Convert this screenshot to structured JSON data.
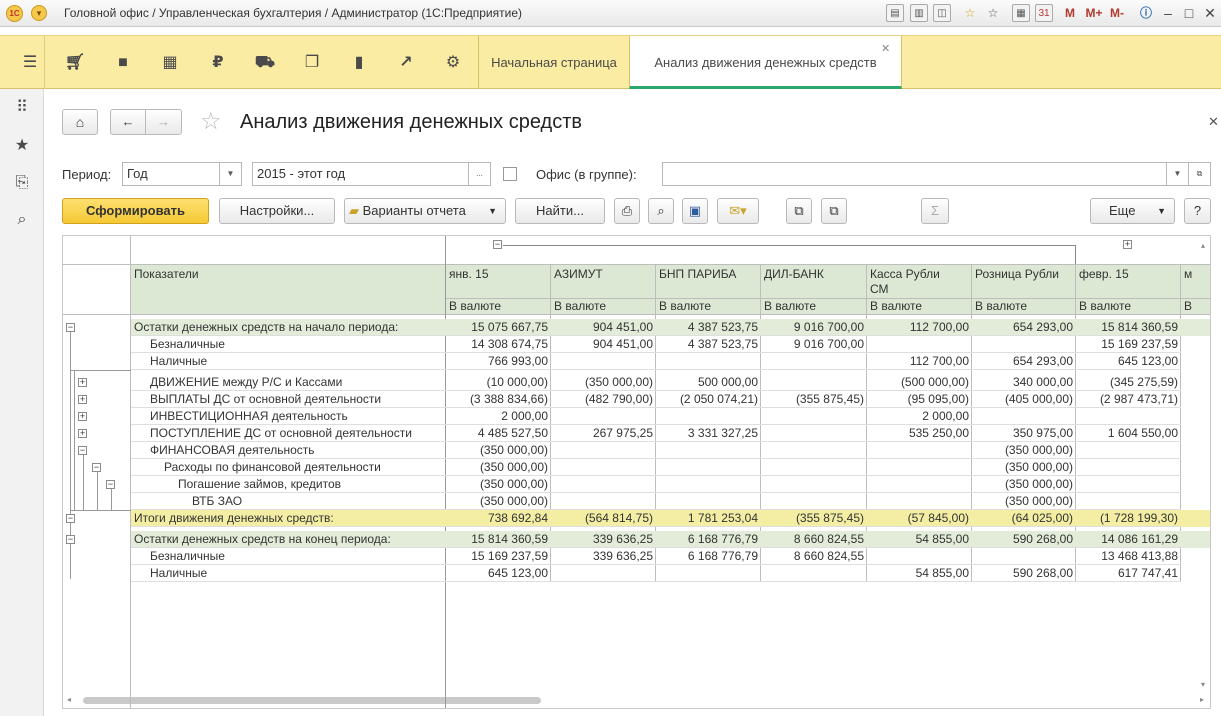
{
  "window": {
    "title": "Головной офис / Управленческая бухгалтерия / Администратор  (1С:Предприятие)",
    "logo_text": "1С",
    "m_buttons": [
      "M",
      "M+",
      "M-"
    ]
  },
  "tabs": {
    "home": "Начальная страница",
    "active": "Анализ движения денежных средств"
  },
  "form": {
    "title": "Анализ движения денежных средств",
    "period_label": "Период:",
    "period_type": "Год",
    "period_value": "2015 - этот год",
    "period_dots": "...",
    "office_label": "Офис (в группе):",
    "office_value": ""
  },
  "toolbar": {
    "generate": "Сформировать",
    "settings": "Настройки...",
    "variants": "Варианты отчета",
    "find": "Найти...",
    "sigma": "Σ",
    "more": "Еще",
    "help": "?"
  },
  "report": {
    "indicator_header": "Показатели",
    "columns": [
      {
        "name": "янв. 15",
        "sub": "В валюте"
      },
      {
        "name": "АЗИМУТ",
        "sub": "В валюте"
      },
      {
        "name": "БНП ПАРИБА",
        "sub": "В валюте"
      },
      {
        "name": "ДИЛ-БАНК",
        "sub": "В валюте"
      },
      {
        "name": "Касса Рубли",
        "name2": "СМ",
        "sub": "В валюте"
      },
      {
        "name": "Розница Рубли",
        "sub": "В валюте"
      },
      {
        "name": "февр. 15",
        "sub": "В валюте"
      },
      {
        "name": "м",
        "sub": "В"
      }
    ],
    "rows": [
      {
        "label": "Остатки денежных средств на начало периода:",
        "values": [
          "15 075 667,75",
          "904 451,00",
          "4 387 523,75",
          "9 016 700,00",
          "112 700,00",
          "654 293,00",
          "15 814 360,59"
        ]
      },
      {
        "label": "Безналичные",
        "values": [
          "14 308 674,75",
          "904 451,00",
          "4 387 523,75",
          "9 016 700,00",
          "",
          "",
          "15 169 237,59"
        ]
      },
      {
        "label": "Наличные",
        "values": [
          "766 993,00",
          "",
          "",
          "",
          "112 700,00",
          "654 293,00",
          "645 123,00"
        ]
      },
      {
        "label": "ДВИЖЕНИЕ между Р/С и Кассами",
        "values": [
          "(10 000,00)",
          "(350 000,00)",
          "500 000,00",
          "",
          "(500 000,00)",
          "340 000,00",
          "(345 275,59)"
        ]
      },
      {
        "label": "ВЫПЛАТЫ ДС от основной деятельности",
        "values": [
          "(3 388 834,66)",
          "(482 790,00)",
          "(2 050 074,21)",
          "(355 875,45)",
          "(95 095,00)",
          "(405 000,00)",
          "(2 987 473,71)"
        ]
      },
      {
        "label": "ИНВЕСТИЦИОННАЯ деятельность",
        "values": [
          "2 000,00",
          "",
          "",
          "",
          "2 000,00",
          "",
          ""
        ]
      },
      {
        "label": "ПОСТУПЛЕНИЕ ДС от основной деятельности",
        "values": [
          "4 485 527,50",
          "267 975,25",
          "3 331 327,25",
          "",
          "535 250,00",
          "350 975,00",
          "1 604 550,00"
        ]
      },
      {
        "label": "ФИНАНСОВАЯ деятельность",
        "values": [
          "(350 000,00)",
          "",
          "",
          "",
          "",
          "(350 000,00)",
          ""
        ]
      },
      {
        "label": "Расходы по финансовой деятельности",
        "values": [
          "(350 000,00)",
          "",
          "",
          "",
          "",
          "(350 000,00)",
          ""
        ]
      },
      {
        "label": "Погашение займов, кредитов",
        "values": [
          "(350 000,00)",
          "",
          "",
          "",
          "",
          "(350 000,00)",
          ""
        ]
      },
      {
        "label": "ВТБ ЗАО",
        "values": [
          "(350 000,00)",
          "",
          "",
          "",
          "",
          "(350 000,00)",
          ""
        ]
      },
      {
        "label": "Итоги движения денежных средств:",
        "values": [
          "738 692,84",
          "(564 814,75)",
          "1 781 253,04",
          "(355 875,45)",
          "(57 845,00)",
          "(64 025,00)",
          "(1 728 199,30)"
        ]
      },
      {
        "label": "Остатки денежных средств на конец периода:",
        "values": [
          "15 814 360,59",
          "339 636,25",
          "6 168 776,79",
          "8 660 824,55",
          "54 855,00",
          "590 268,00",
          "14 086 161,29"
        ]
      },
      {
        "label": "Безналичные",
        "values": [
          "15 169 237,59",
          "339 636,25",
          "6 168 776,79",
          "8 660 824,55",
          "",
          "",
          "13 468 413,88"
        ]
      },
      {
        "label": "Наличные",
        "values": [
          "645 123,00",
          "",
          "",
          "",
          "54 855,00",
          "590 268,00",
          "617 747,41"
        ]
      }
    ]
  }
}
